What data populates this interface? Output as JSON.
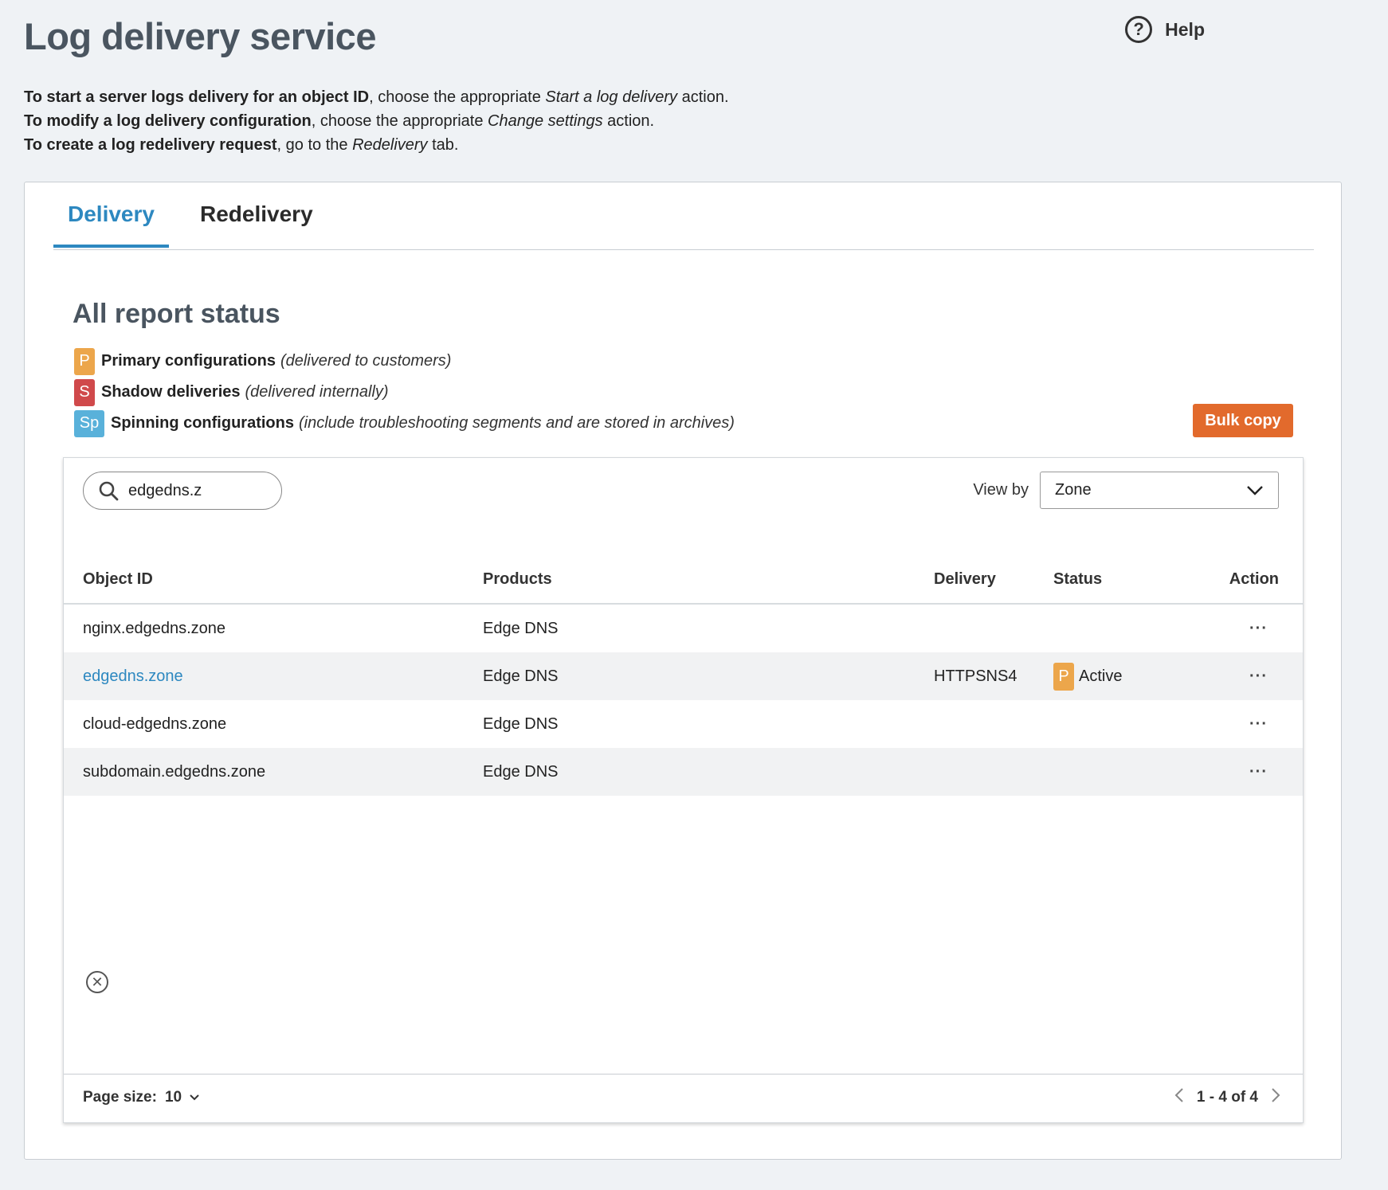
{
  "page": {
    "title": "Log delivery service",
    "help_label": "Help"
  },
  "intro": {
    "line1_bold": "To start a server logs delivery for an object ID",
    "line1_text": ", choose the appropriate ",
    "line1_italic": "Start a log delivery",
    "line1_end": " action.",
    "line2_bold": "To modify a log delivery configuration",
    "line2_text": ", choose the appropriate ",
    "line2_italic": "Change settings",
    "line2_end": " action.",
    "line3_bold": "To create a log redelivery request",
    "line3_text": ", go to the ",
    "line3_italic": "Redelivery",
    "line3_end": " tab."
  },
  "tabs": [
    {
      "label": "Delivery",
      "active": true
    },
    {
      "label": "Redelivery",
      "active": false
    }
  ],
  "section": {
    "title": "All report status"
  },
  "legend": [
    {
      "badge": "P",
      "label": "Primary configurations",
      "note": "(delivered to customers)",
      "color": "#eca64b"
    },
    {
      "badge": "S",
      "label": "Shadow deliveries",
      "note": "(delivered internally)",
      "color": "#d0494b"
    },
    {
      "badge": "Sp",
      "label": "Spinning configurations",
      "note": "(include troubleshooting segments and are stored in archives)",
      "color": "#59b1da"
    }
  ],
  "bulk_copy_label": "Bulk copy",
  "search": {
    "value": "edgedns.z",
    "icon": "search-icon"
  },
  "view_by": {
    "label": "View by",
    "selected": "Zone"
  },
  "table": {
    "headers": {
      "object_id": "Object ID",
      "products": "Products",
      "delivery": "Delivery",
      "status": "Status",
      "action": "Action"
    },
    "rows": [
      {
        "object_id": "nginx.edgedns.zone",
        "products": "Edge DNS",
        "delivery": "",
        "status_badge": "",
        "status": "",
        "action": "···"
      },
      {
        "object_id": "edgedns.zone",
        "products": "Edge DNS",
        "delivery": "HTTPSNS4",
        "status_badge": "P",
        "status": "Active",
        "action": "···"
      },
      {
        "object_id": "cloud-edgedns.zone",
        "products": "Edge DNS",
        "delivery": "",
        "status_badge": "",
        "status": "",
        "action": "···"
      },
      {
        "object_id": "subdomain.edgedns.zone",
        "products": "Edge DNS",
        "delivery": "",
        "status_badge": "",
        "status": "",
        "action": "···"
      }
    ]
  },
  "footer": {
    "page_size_label": "Page size:",
    "page_size_value": "10",
    "range": "1 - 4 of 4"
  },
  "colors": {
    "accent": "#2d88c0",
    "primary_button": "#e26a2c",
    "page_bg": "#eff2f5"
  }
}
